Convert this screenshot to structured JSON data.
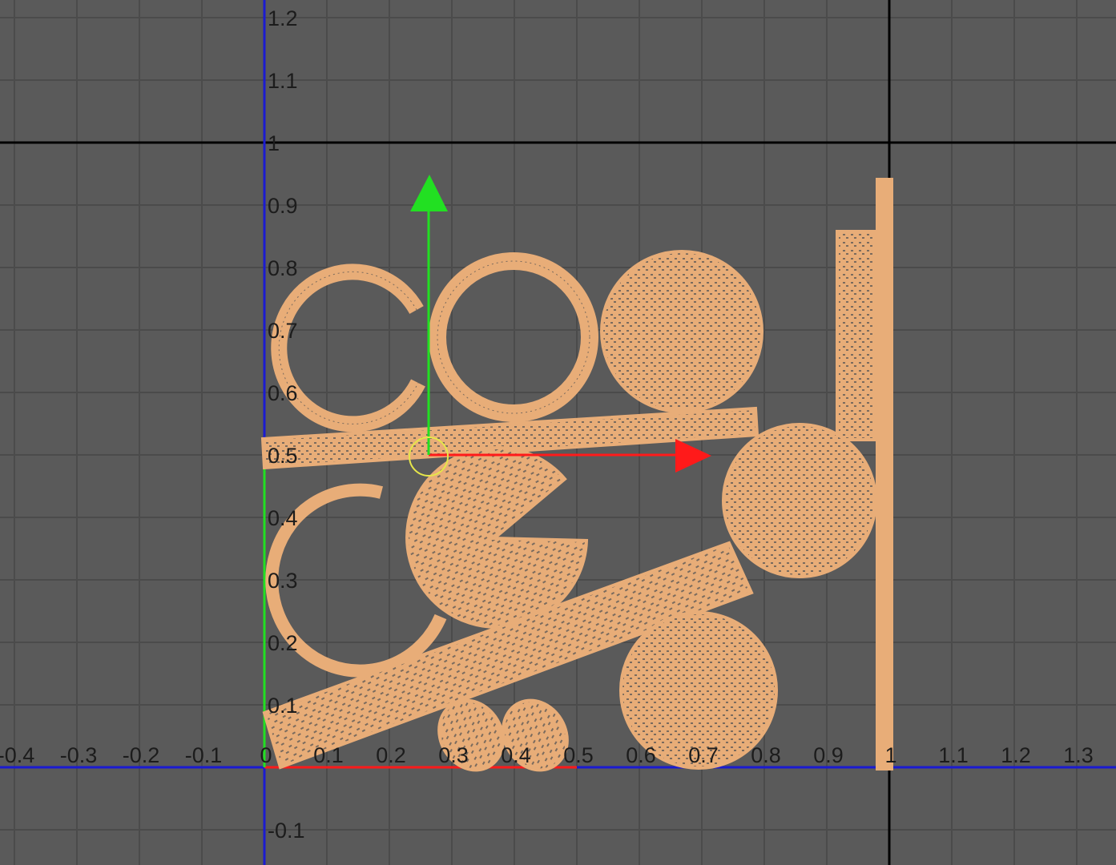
{
  "editor": {
    "name": "UV Editor",
    "background_color": "#5a5a5a",
    "grid_color": "#4b4b4b",
    "axis_u_color": "#1b1bd0",
    "axis_v_color": "#1b1bd0",
    "border_color": "#000000",
    "uv_shell_color": "#e8ad78"
  },
  "x_ticks": [
    "-0.4",
    "-0.3",
    "-0.2",
    "-0.1",
    "0",
    "0.1",
    "0.2",
    "0.3",
    "0.4",
    "0.5",
    "0.6",
    "0.7",
    "0.8",
    "0.9",
    "1",
    "1.1",
    "1.2",
    "1.3"
  ],
  "y_ticks": [
    "1.2",
    "1.1",
    "1",
    "0.9",
    "0.8",
    "0.7",
    "0.6",
    "0.5",
    "0.4",
    "0.3",
    "0.2",
    "0.1",
    "-0.1"
  ],
  "manipulator": {
    "u_axis_color": "#ff1a1a",
    "v_axis_color": "#22e022",
    "center_color": "#e6e64a"
  },
  "uv_shells": [
    "ring-large-left",
    "ring-large-middle",
    "disc-top-right",
    "strip-horizontal",
    "strip-vertical-right",
    "strip-vertical-tall",
    "ring-open-lower-left",
    "disc-sliced-middle",
    "disc-middle-right",
    "strip-diagonal",
    "disc-bottom-right",
    "small-disc-a",
    "small-disc-b"
  ]
}
